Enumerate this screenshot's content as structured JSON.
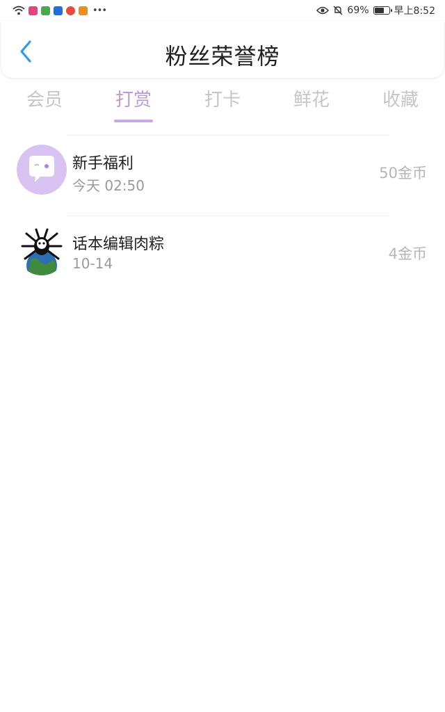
{
  "status_bar": {
    "battery": "69%",
    "battery_level": 0.69,
    "time": "早上8:52",
    "app_icon_colors": [
      "#e8417d",
      "#4aa84f",
      "#1f6fe0",
      "#e94a3a",
      "#f08c1d"
    ]
  },
  "header": {
    "title": "粉丝荣誉榜",
    "back_icon": "chevron-left-icon",
    "back_color": "#2a9bf0"
  },
  "tabs": [
    {
      "label": "会员",
      "active": false
    },
    {
      "label": "打赏",
      "active": true
    },
    {
      "label": "打卡",
      "active": false
    },
    {
      "label": "鲜花",
      "active": false
    },
    {
      "label": "收藏",
      "active": false
    }
  ],
  "accent_color": "#b99ad9",
  "list": [
    {
      "name": "新手福利",
      "time": "今天 02:50",
      "amount": "50金币",
      "avatar": "chat-bubble-avatar"
    },
    {
      "name": "话本编辑肉粽",
      "time": "10-14",
      "amount": "4金币",
      "avatar": "bug-earth-avatar"
    }
  ]
}
